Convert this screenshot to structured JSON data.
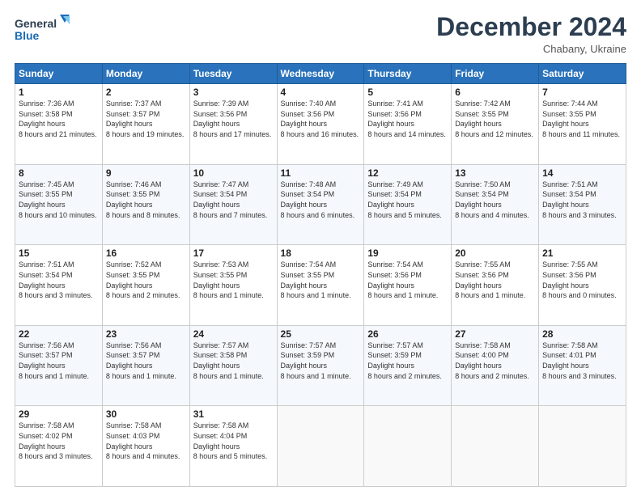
{
  "logo": {
    "line1": "General",
    "line2": "Blue"
  },
  "header": {
    "month_year": "December 2024",
    "location": "Chabany, Ukraine"
  },
  "days_of_week": [
    "Sunday",
    "Monday",
    "Tuesday",
    "Wednesday",
    "Thursday",
    "Friday",
    "Saturday"
  ],
  "weeks": [
    [
      {
        "day": "1",
        "sunrise": "7:36 AM",
        "sunset": "3:58 PM",
        "daylight": "8 hours and 21 minutes."
      },
      {
        "day": "2",
        "sunrise": "7:37 AM",
        "sunset": "3:57 PM",
        "daylight": "8 hours and 19 minutes."
      },
      {
        "day": "3",
        "sunrise": "7:39 AM",
        "sunset": "3:56 PM",
        "daylight": "8 hours and 17 minutes."
      },
      {
        "day": "4",
        "sunrise": "7:40 AM",
        "sunset": "3:56 PM",
        "daylight": "8 hours and 16 minutes."
      },
      {
        "day": "5",
        "sunrise": "7:41 AM",
        "sunset": "3:56 PM",
        "daylight": "8 hours and 14 minutes."
      },
      {
        "day": "6",
        "sunrise": "7:42 AM",
        "sunset": "3:55 PM",
        "daylight": "8 hours and 12 minutes."
      },
      {
        "day": "7",
        "sunrise": "7:44 AM",
        "sunset": "3:55 PM",
        "daylight": "8 hours and 11 minutes."
      }
    ],
    [
      {
        "day": "8",
        "sunrise": "7:45 AM",
        "sunset": "3:55 PM",
        "daylight": "8 hours and 10 minutes."
      },
      {
        "day": "9",
        "sunrise": "7:46 AM",
        "sunset": "3:55 PM",
        "daylight": "8 hours and 8 minutes."
      },
      {
        "day": "10",
        "sunrise": "7:47 AM",
        "sunset": "3:54 PM",
        "daylight": "8 hours and 7 minutes."
      },
      {
        "day": "11",
        "sunrise": "7:48 AM",
        "sunset": "3:54 PM",
        "daylight": "8 hours and 6 minutes."
      },
      {
        "day": "12",
        "sunrise": "7:49 AM",
        "sunset": "3:54 PM",
        "daylight": "8 hours and 5 minutes."
      },
      {
        "day": "13",
        "sunrise": "7:50 AM",
        "sunset": "3:54 PM",
        "daylight": "8 hours and 4 minutes."
      },
      {
        "day": "14",
        "sunrise": "7:51 AM",
        "sunset": "3:54 PM",
        "daylight": "8 hours and 3 minutes."
      }
    ],
    [
      {
        "day": "15",
        "sunrise": "7:51 AM",
        "sunset": "3:54 PM",
        "daylight": "8 hours and 3 minutes."
      },
      {
        "day": "16",
        "sunrise": "7:52 AM",
        "sunset": "3:55 PM",
        "daylight": "8 hours and 2 minutes."
      },
      {
        "day": "17",
        "sunrise": "7:53 AM",
        "sunset": "3:55 PM",
        "daylight": "8 hours and 1 minute."
      },
      {
        "day": "18",
        "sunrise": "7:54 AM",
        "sunset": "3:55 PM",
        "daylight": "8 hours and 1 minute."
      },
      {
        "day": "19",
        "sunrise": "7:54 AM",
        "sunset": "3:56 PM",
        "daylight": "8 hours and 1 minute."
      },
      {
        "day": "20",
        "sunrise": "7:55 AM",
        "sunset": "3:56 PM",
        "daylight": "8 hours and 1 minute."
      },
      {
        "day": "21",
        "sunrise": "7:55 AM",
        "sunset": "3:56 PM",
        "daylight": "8 hours and 0 minutes."
      }
    ],
    [
      {
        "day": "22",
        "sunrise": "7:56 AM",
        "sunset": "3:57 PM",
        "daylight": "8 hours and 1 minute."
      },
      {
        "day": "23",
        "sunrise": "7:56 AM",
        "sunset": "3:57 PM",
        "daylight": "8 hours and 1 minute."
      },
      {
        "day": "24",
        "sunrise": "7:57 AM",
        "sunset": "3:58 PM",
        "daylight": "8 hours and 1 minute."
      },
      {
        "day": "25",
        "sunrise": "7:57 AM",
        "sunset": "3:59 PM",
        "daylight": "8 hours and 1 minute."
      },
      {
        "day": "26",
        "sunrise": "7:57 AM",
        "sunset": "3:59 PM",
        "daylight": "8 hours and 2 minutes."
      },
      {
        "day": "27",
        "sunrise": "7:58 AM",
        "sunset": "4:00 PM",
        "daylight": "8 hours and 2 minutes."
      },
      {
        "day": "28",
        "sunrise": "7:58 AM",
        "sunset": "4:01 PM",
        "daylight": "8 hours and 3 minutes."
      }
    ],
    [
      {
        "day": "29",
        "sunrise": "7:58 AM",
        "sunset": "4:02 PM",
        "daylight": "8 hours and 3 minutes."
      },
      {
        "day": "30",
        "sunrise": "7:58 AM",
        "sunset": "4:03 PM",
        "daylight": "8 hours and 4 minutes."
      },
      {
        "day": "31",
        "sunrise": "7:58 AM",
        "sunset": "4:04 PM",
        "daylight": "8 hours and 5 minutes."
      },
      null,
      null,
      null,
      null
    ]
  ]
}
